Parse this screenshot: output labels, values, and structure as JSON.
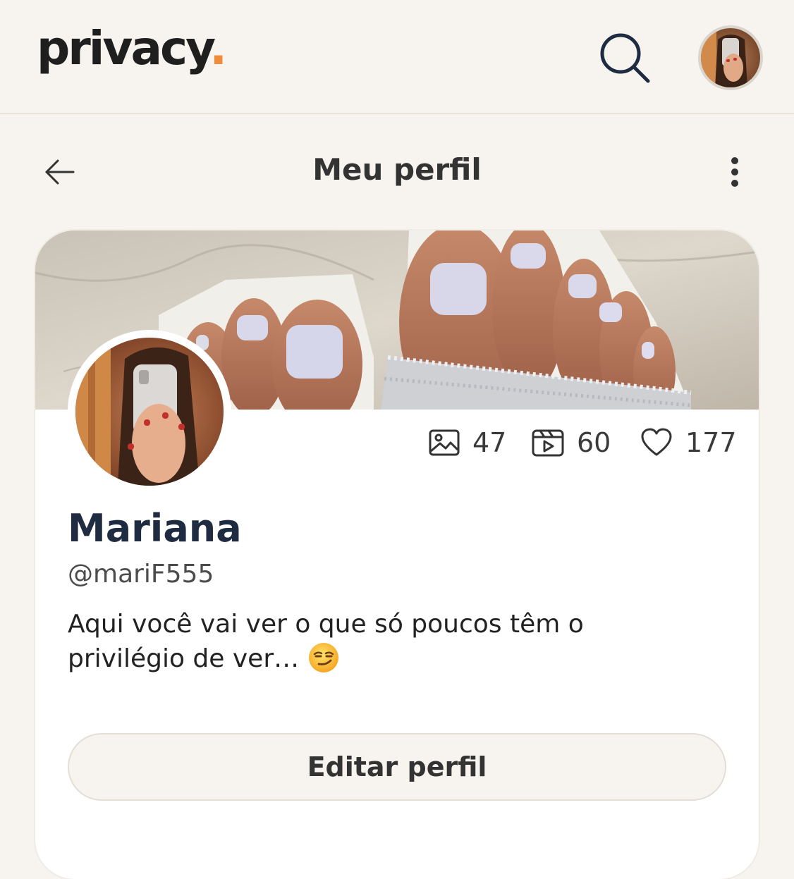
{
  "brand": {
    "name": "privacy",
    "dot": ".",
    "accent_color": "#f08b3b"
  },
  "topbar": {
    "search_icon": "search-icon",
    "avatar_icon": "user-avatar"
  },
  "header": {
    "title": "Meu perfil",
    "back_icon": "arrow-left-icon",
    "more_icon": "more-vertical-icon"
  },
  "profile": {
    "name": "Mariana",
    "handle": "@mariF555",
    "bio": "Aqui você vai ver o que só poucos têm o privilégio de ver…",
    "bio_emoji": "smirking-face-emoji"
  },
  "stats": [
    {
      "icon": "image-icon",
      "value": "47"
    },
    {
      "icon": "video-icon",
      "value": "60"
    },
    {
      "icon": "heart-icon",
      "value": "177"
    }
  ],
  "actions": {
    "edit_label": "Editar perfil"
  }
}
